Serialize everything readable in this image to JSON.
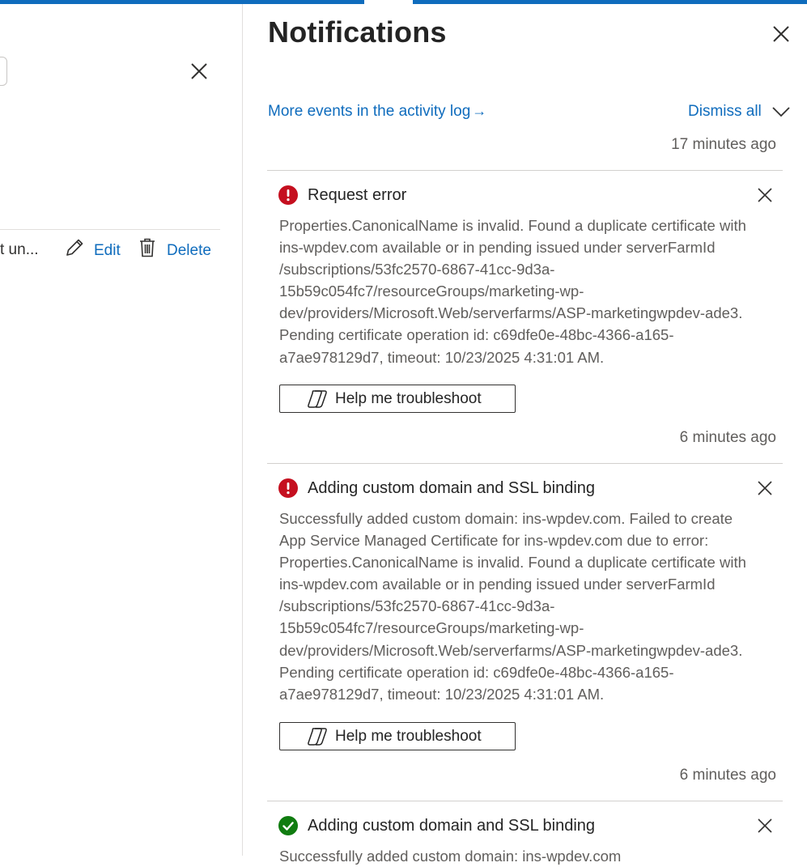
{
  "left_pane": {
    "truncated_text": "t un...",
    "edit_label": "Edit",
    "delete_label": "Delete"
  },
  "panel": {
    "title": "Notifications",
    "activity_link": "More events in the activity log",
    "activity_arrow": "→",
    "dismiss_all": "Dismiss all",
    "top_time": "17 minutes ago"
  },
  "notifications": [
    {
      "status": "error",
      "title": "Request error",
      "body_lines": [
        "Properties.CanonicalName is invalid.  Found a duplicate certificate with",
        "ins-wpdev.com available or in pending issued under serverFarmId",
        "/subscriptions/53fc2570-6867-41cc-9d3a-",
        "15b59c054fc7/resourceGroups/marketing-wp-",
        "dev/providers/Microsoft.Web/serverfarms/ASP-marketingwpdev-ade3.",
        "Pending certificate operation id: c69dfe0e-48bc-4366-a165-",
        "a7ae978129d7, timeout: 10/23/2025 4:31:01 AM."
      ],
      "button_label": "Help me troubleshoot",
      "time": "6 minutes ago"
    },
    {
      "status": "error",
      "title": "Adding custom domain and SSL binding",
      "body_lines": [
        "Successfully added custom domain: ins-wpdev.com. Failed to create",
        "App Service Managed Certificate for ins-wpdev.com due to error:",
        "Properties.CanonicalName is invalid.  Found a duplicate certificate with",
        "ins-wpdev.com available or in pending issued under serverFarmId",
        "/subscriptions/53fc2570-6867-41cc-9d3a-",
        "15b59c054fc7/resourceGroups/marketing-wp-",
        "dev/providers/Microsoft.Web/serverfarms/ASP-marketingwpdev-ade3.",
        "Pending certificate operation id: c69dfe0e-48bc-4366-a165-",
        "a7ae978129d7, timeout: 10/23/2025 4:31:01 AM."
      ],
      "button_label": "Help me troubleshoot",
      "time": "6 minutes ago"
    },
    {
      "status": "success",
      "title": "Adding custom domain and SSL binding",
      "body_lines": [
        "Successfully added custom domain: ins-wpdev.com"
      ]
    }
  ],
  "colors": {
    "accent": "#0f6cbd",
    "error": "#c50f1f",
    "success": "#107c10"
  },
  "icons": {
    "error": "error-circle-icon",
    "success": "checkmark-circle-icon",
    "copilot": "copilot-icon"
  }
}
